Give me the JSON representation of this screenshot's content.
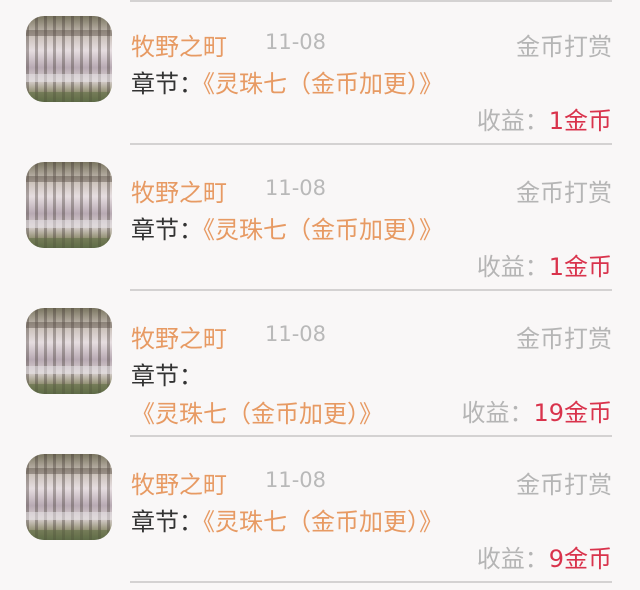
{
  "records": [
    {
      "name": "牧野之町",
      "date": "11-08",
      "type": "金币打赏",
      "chapter_label": "章节：",
      "chapter_title": "《灵珠七（金币加更）》",
      "income_label": "收益：",
      "income_value": "1金币"
    },
    {
      "name": "牧野之町",
      "date": "11-08",
      "type": "金币打赏",
      "chapter_label": "章节：",
      "chapter_title": "《灵珠七（金币加更）》",
      "income_label": "收益：",
      "income_value": "1金币"
    },
    {
      "name": "牧野之町",
      "date": "11-08",
      "type": "金币打赏",
      "chapter_label": "章节：",
      "chapter_title": "《灵珠七（金币加更）》",
      "income_label": "收益：",
      "income_value": "19金币"
    },
    {
      "name": "牧野之町",
      "date": "11-08",
      "type": "金币打赏",
      "chapter_label": "章节：",
      "chapter_title": "《灵珠七（金币加更）》",
      "income_label": "收益：",
      "income_value": "9金币"
    }
  ]
}
